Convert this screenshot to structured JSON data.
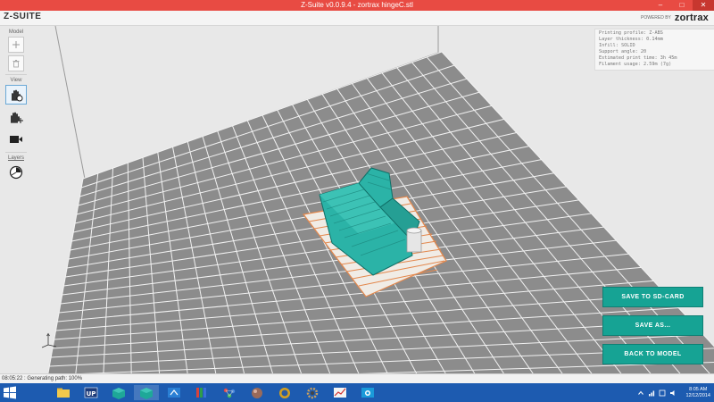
{
  "window": {
    "title": "Z-Suite v0.0.9.4 - zortrax hingeC.stl",
    "minimize": "–",
    "maximize": "□",
    "close": "✕"
  },
  "header": {
    "brand": "Z-SUITE",
    "powered_by": "POWERED BY",
    "logo": "zortrax"
  },
  "toolbar": {
    "model_label": "Model",
    "view_label": "View",
    "layers_label": "Layers",
    "buttons": [
      {
        "icon": "plus-icon",
        "section": "model"
      },
      {
        "icon": "trash-icon",
        "section": "model"
      },
      {
        "icon": "hand-rotate-icon",
        "section": "view",
        "active": true
      },
      {
        "icon": "hand-move-icon",
        "section": "view"
      },
      {
        "icon": "camera-icon",
        "section": "view"
      },
      {
        "icon": "layers-dial-icon",
        "section": "layers"
      }
    ]
  },
  "print_info": {
    "profile": "Printing profile: Z-ABS",
    "layer_thickness": "Layer thickness: 0.14mm",
    "infill": "Infill: SOLID",
    "support_angle": "Support angle: 20",
    "print_time": "Estimated print time: 3h 45m",
    "filament": "Filament usage: 2.59m (7g)"
  },
  "actions": {
    "save_sd": "SAVE TO SD-CARD",
    "save_as": "SAVE AS...",
    "back": "BACK TO MODEL"
  },
  "status": {
    "text": "08:05:22 : Generating path: 100%"
  },
  "taskbar": {
    "clock_time": "8:05 AM",
    "clock_date": "12/12/2014",
    "apps": [
      "file-explorer-icon",
      "up-app-icon",
      "z-suite-icon",
      "z-suite-active-icon",
      "tool-icon",
      "library-icon",
      "molecule-icon",
      "sphere-icon",
      "globe-icon",
      "gear-icon",
      "chart-icon",
      "camera-app-icon"
    ]
  },
  "colors": {
    "title_bar": "#e84b43",
    "accent_button": "#16a394",
    "model": "#2bb3a7",
    "raft": "#e3884d",
    "floor_tile": "#8c8c8c",
    "taskbar": "#1d5bb0"
  }
}
